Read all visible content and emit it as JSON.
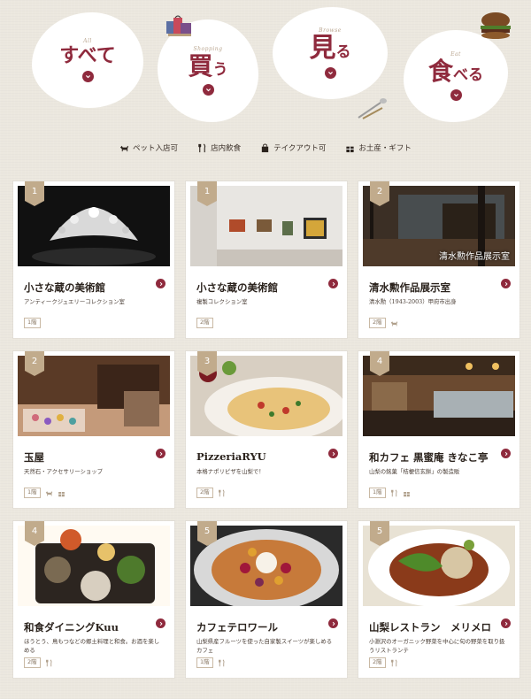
{
  "categories": [
    {
      "id": "all",
      "sub": "All",
      "big": "すべて",
      "small": ""
    },
    {
      "id": "buy",
      "sub": "Shopping",
      "big": "買",
      "small": "う"
    },
    {
      "id": "see",
      "sub": "Browse",
      "big": "見",
      "small": "る"
    },
    {
      "id": "eat",
      "sub": "Eat",
      "big": "食",
      "small": "べる"
    }
  ],
  "legend": [
    {
      "icon": "dog-icon",
      "label": "ペット入店可"
    },
    {
      "icon": "fork-knife-icon",
      "label": "店内飲食"
    },
    {
      "icon": "takeout-bag-icon",
      "label": "テイクアウト可"
    },
    {
      "icon": "gift-icon",
      "label": "お土産・ギフト"
    }
  ],
  "cards": [
    {
      "badge": "1",
      "title": "小さな蔵の美術館",
      "desc": "アンティークジュエリーコレクション室",
      "floor": "1階",
      "icons": [],
      "caption": "",
      "photo": "tiara"
    },
    {
      "badge": "1",
      "title": "小さな蔵の美術館",
      "desc": "複製コレクション室",
      "floor": "2階",
      "icons": [],
      "caption": "",
      "photo": "gallery"
    },
    {
      "badge": "2",
      "title": "清水勲作品展示室",
      "desc": "清水勲（1943-2003）甲府市出身",
      "floor": "2階",
      "icons": [
        "dog-icon"
      ],
      "caption": "清水勲作品展示室",
      "photo": "room"
    },
    {
      "badge": "2",
      "title": "玉屋",
      "desc": "天然石・アクセサリーショップ",
      "floor": "1階",
      "icons": [
        "dog-icon",
        "gift-icon"
      ],
      "caption": "",
      "photo": "shop"
    },
    {
      "badge": "3",
      "title": "PizzeriaRYU",
      "desc": "本格ナポリピザを山梨で！",
      "floor": "2階",
      "icons": [
        "fork-knife-icon"
      ],
      "caption": "",
      "photo": "pizza"
    },
    {
      "badge": "4",
      "title": "和カフェ 黒蜜庵 きなこ亭",
      "desc": "山梨の銘菓「桔梗信玄餅」の製造販",
      "floor": "1階",
      "icons": [
        "fork-knife-icon",
        "gift-icon"
      ],
      "caption": "",
      "photo": "cafe"
    },
    {
      "badge": "4",
      "title": "和食ダイニングKuu",
      "desc": "ほうとう、鳥もつなどの郷土料理と和食。お酒を楽しめる",
      "floor": "2階",
      "icons": [
        "fork-knife-icon"
      ],
      "caption": "",
      "photo": "washoku"
    },
    {
      "badge": "5",
      "title": "カフェテロワール",
      "desc": "山梨県産フルーツを使った自家製スイーツが楽しめるカフェ",
      "floor": "1階",
      "icons": [
        "fork-knife-icon"
      ],
      "caption": "",
      "photo": "tart"
    },
    {
      "badge": "5",
      "title": "山梨レストラン　メリメロ",
      "desc": "小淵沢のオーガニック野菜を中心に旬の野菜を取り扱うリストランテ",
      "floor": "2階",
      "icons": [
        "fork-knife-icon"
      ],
      "caption": "",
      "photo": "plate"
    }
  ],
  "colors": {
    "accent": "#8f2a3d",
    "badge": "#c1ab8c",
    "background": "#ece8df"
  }
}
